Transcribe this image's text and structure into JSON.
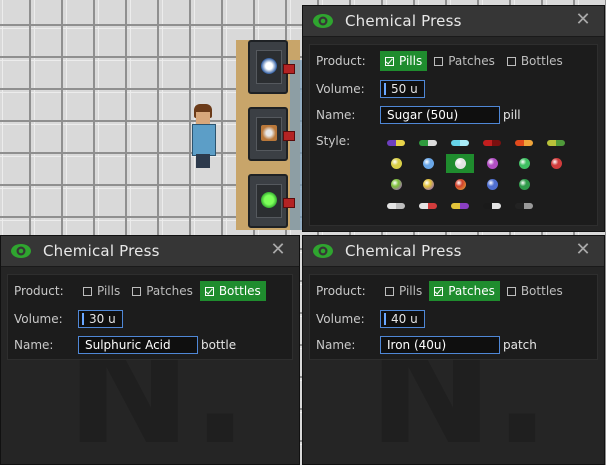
{
  "colors": {
    "accent_green": "#1f8c2e",
    "input_border": "#4f87d6",
    "window_bg": "#252525",
    "titlebar_bg": "#363636"
  },
  "watermark": {
    "text": "N."
  },
  "windows": [
    {
      "title": "Chemical Press",
      "product_label": "Product:",
      "products": [
        {
          "label": "Pills",
          "selected": true
        },
        {
          "label": "Patches",
          "selected": false
        },
        {
          "label": "Bottles",
          "selected": false
        }
      ],
      "volume_label": "Volume:",
      "volume_value": "50 u",
      "name_label": "Name:",
      "name_value": "Sugar (50u)",
      "name_suffix": "pill",
      "style_label": "Style:",
      "styles": [
        {
          "icon": "pill-capsule-purple-yellow",
          "colors": [
            "#6e3fbf",
            "#e8d34a"
          ],
          "shape": "pill",
          "selected": false
        },
        {
          "icon": "pill-capsule-green-white",
          "colors": [
            "#2f9a3d",
            "#dcdcdc"
          ],
          "shape": "pill",
          "selected": false
        },
        {
          "icon": "pill-capsule-cyan",
          "colors": [
            "#66d3e8",
            "#a9ecf7"
          ],
          "shape": "pill",
          "selected": false
        },
        {
          "icon": "pill-capsule-red",
          "colors": [
            "#c21e1e",
            "#7a1010"
          ],
          "shape": "pill",
          "selected": false
        },
        {
          "icon": "pill-capsule-red-orange",
          "colors": [
            "#e24a1c",
            "#f0a43a"
          ],
          "shape": "pill",
          "selected": false
        },
        {
          "icon": "pill-capsule-yellow-green",
          "colors": [
            "#b9c23a",
            "#4f9a3a"
          ],
          "shape": "pill",
          "selected": false
        },
        {
          "icon": "pill-round-yellow",
          "colors": [
            "#d9cf48"
          ],
          "shape": "dot",
          "selected": false
        },
        {
          "icon": "pill-round-blue",
          "colors": [
            "#6aa7e8"
          ],
          "shape": "dot",
          "selected": false
        },
        {
          "icon": "pill-round-white",
          "colors": [
            "#e3e3e3"
          ],
          "shape": "dot",
          "selected": true
        },
        {
          "icon": "pill-round-purple",
          "colors": [
            "#b14fc2"
          ],
          "shape": "dot",
          "selected": false
        },
        {
          "icon": "pill-round-green",
          "colors": [
            "#3fbf62"
          ],
          "shape": "dot",
          "selected": false
        },
        {
          "icon": "pill-round-red",
          "colors": [
            "#d23c3c"
          ],
          "shape": "dot",
          "selected": false
        },
        {
          "icon": "pill-round-green-purple",
          "colors": [
            "#7ec23a",
            "#a24fd0"
          ],
          "shape": "dot",
          "selected": false
        },
        {
          "icon": "pill-round-yellow-purple",
          "colors": [
            "#e3c33a",
            "#7a4fd0"
          ],
          "shape": "dot",
          "selected": false
        },
        {
          "icon": "pill-round-red-yellow",
          "colors": [
            "#d0402c",
            "#e3b03a"
          ],
          "shape": "dot",
          "selected": false
        },
        {
          "icon": "pill-round-blue-dark",
          "colors": [
            "#4f6fd0"
          ],
          "shape": "dot",
          "selected": false
        },
        {
          "icon": "pill-round-green-dark",
          "colors": [
            "#2f9a4a"
          ],
          "shape": "dot",
          "selected": false
        },
        {
          "icon": "pill-capsule-white",
          "colors": [
            "#e3e3e3",
            "#bdbdbd"
          ],
          "shape": "pill",
          "selected": false
        },
        {
          "icon": "pill-capsule-white-red",
          "colors": [
            "#e3e3e3",
            "#d23c3c"
          ],
          "shape": "pill",
          "selected": false
        },
        {
          "icon": "pill-capsule-yellow-purple",
          "colors": [
            "#e3c33a",
            "#8a3fc2"
          ],
          "shape": "pill",
          "selected": false
        },
        {
          "icon": "pill-capsule-black-white",
          "colors": [
            "#1a1a1a",
            "#e3e3e3"
          ],
          "shape": "pill",
          "selected": false
        },
        {
          "icon": "pill-capsule-black-gray",
          "colors": [
            "#222222",
            "#9a9a9a"
          ],
          "shape": "pill",
          "selected": false
        }
      ]
    },
    {
      "title": "Chemical Press",
      "product_label": "Product:",
      "products": [
        {
          "label": "Pills",
          "selected": false
        },
        {
          "label": "Patches",
          "selected": false
        },
        {
          "label": "Bottles",
          "selected": true
        }
      ],
      "volume_label": "Volume:",
      "volume_value": "30 u",
      "name_label": "Name:",
      "name_value": "Sulphuric Acid",
      "name_suffix": "bottle"
    },
    {
      "title": "Chemical Press",
      "product_label": "Product:",
      "products": [
        {
          "label": "Pills",
          "selected": false
        },
        {
          "label": "Patches",
          "selected": true
        },
        {
          "label": "Bottles",
          "selected": false
        }
      ],
      "volume_label": "Volume:",
      "volume_value": "40 u",
      "name_label": "Name:",
      "name_value": "Iron (40u)",
      "name_suffix": "patch"
    }
  ]
}
